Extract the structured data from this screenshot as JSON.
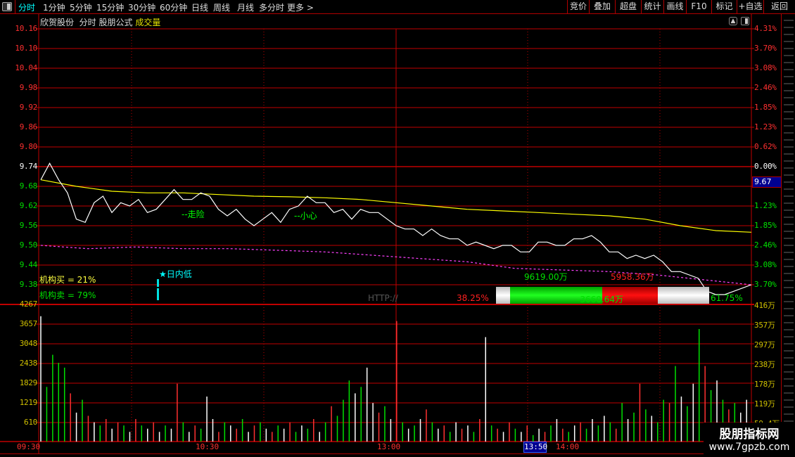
{
  "toolbar": {
    "period_tabs": [
      "分时",
      "1分钟",
      "5分钟",
      "15分钟",
      "30分钟",
      "60分钟",
      "日线",
      "周线",
      "月线",
      "多分时",
      "更多 >"
    ],
    "active_tab": "分时",
    "right_buttons": [
      "竞价",
      "叠加",
      "超盘",
      "统计",
      "画线",
      "F10",
      "标记",
      "+自选",
      "返回"
    ]
  },
  "header": {
    "stock_name": "欣贺股份",
    "view": "分时",
    "formula": "股朋公式",
    "indicator": "成交量"
  },
  "price_axis_left": [
    "10.16",
    "10.10",
    "10.04",
    "9.98",
    "9.92",
    "9.86",
    "9.80",
    "9.74",
    "9.68",
    "9.62",
    "9.56",
    "9.50",
    "9.44",
    "9.38"
  ],
  "pct_axis_right": [
    "4.31%",
    "3.70%",
    "3.08%",
    "2.46%",
    "1.85%",
    "1.23%",
    "0.62%",
    "0.00%",
    "",
    "1.23%",
    "1.85%",
    "2.46%",
    "3.08%",
    "3.70%"
  ],
  "current_price_tag": "9.67",
  "volume_axis_left": [
    "4267",
    "3657",
    "3048",
    "2438",
    "1829",
    "1219",
    "610"
  ],
  "volume_axis_right": [
    "416万",
    "357万",
    "297万",
    "238万",
    "178万",
    "119万",
    "59.4万"
  ],
  "time_axis": [
    "09:30",
    "10:30",
    "13:00",
    "13:50",
    "14:00"
  ],
  "annotations": {
    "risk": "--走险",
    "careful": "--小心",
    "intraday_low": "★日内低",
    "inst_buy": "机构买 = 21%",
    "inst_sell": "机构卖 = 79%",
    "http": "HTTP://",
    "buy_pct": "38.25%",
    "sell_pct": "61.75%",
    "net_flow": "-3660.64万",
    "inflow": "9619.00万",
    "outflow": "5958.36万"
  },
  "flow_bar": {
    "buy_fraction": 0.3825,
    "sell_fraction": 0.6175
  },
  "colors": {
    "up": "#ff3030",
    "down": "#00e000",
    "price_line": "#ffffff",
    "avg_line": "#ffff00",
    "ma_line": "#ff40ff",
    "grid": "#c00000",
    "accent": "#00ffff",
    "volume_axis": "#d0c000"
  },
  "series": {
    "price": [
      9.7,
      9.75,
      9.7,
      9.66,
      9.58,
      9.57,
      9.63,
      9.65,
      9.6,
      9.63,
      9.62,
      9.64,
      9.6,
      9.61,
      9.64,
      9.67,
      9.64,
      9.64,
      9.66,
      9.65,
      9.61,
      9.59,
      9.61,
      9.58,
      9.56,
      9.58,
      9.6,
      9.57,
      9.61,
      9.62,
      9.65,
      9.63,
      9.63,
      9.6,
      9.61,
      9.58,
      9.61,
      9.6,
      9.6,
      9.58,
      9.56,
      9.55,
      9.55,
      9.53,
      9.55,
      9.53,
      9.52,
      9.52,
      9.5,
      9.51,
      9.5,
      9.49,
      9.5,
      9.5,
      9.48,
      9.48,
      9.51,
      9.51,
      9.5,
      9.5,
      9.52,
      9.52,
      9.53,
      9.51,
      9.48,
      9.48,
      9.46,
      9.47,
      9.46,
      9.47,
      9.45,
      9.42,
      9.42,
      9.41,
      9.4,
      9.36,
      9.35,
      9.35,
      9.36,
      9.37,
      9.38
    ],
    "avg": [
      9.7,
      9.68,
      9.665,
      9.66,
      9.66,
      9.655,
      9.65,
      9.648,
      9.645,
      9.64,
      9.63,
      9.62,
      9.61,
      9.605,
      9.6,
      9.595,
      9.59,
      9.58,
      9.56,
      9.545,
      9.54
    ],
    "ma": [
      9.5,
      9.49,
      9.495,
      9.49,
      9.49,
      9.485,
      9.48,
      9.47,
      9.46,
      9.45,
      9.43,
      9.425,
      9.42,
      9.41,
      9.395,
      9.38
    ],
    "volume": [
      3900,
      1700,
      2700,
      2450,
      2300,
      1500,
      900,
      1300,
      800,
      600,
      500,
      700,
      400,
      600,
      500,
      300,
      700,
      500,
      400,
      600,
      300,
      500,
      400,
      1800,
      600,
      300,
      500,
      400,
      1400,
      700,
      300,
      600,
      500,
      400,
      700,
      300,
      500,
      600,
      400,
      300,
      500,
      400,
      600,
      300,
      500,
      400,
      700,
      300,
      600,
      1100,
      800,
      1300,
      1900,
      1500,
      1700,
      2300,
      1200,
      900,
      1100,
      700,
      3750,
      600,
      400,
      500,
      700,
      1000,
      600,
      400,
      500,
      300,
      600,
      400,
      500,
      300,
      700,
      3250,
      500,
      400,
      300,
      600,
      400,
      300,
      500,
      200,
      400,
      300,
      500,
      700,
      400,
      300,
      500,
      600,
      400,
      700,
      500,
      800,
      600,
      400,
      1200,
      700,
      900,
      1800,
      1000,
      800,
      600,
      1300,
      1200,
      2350,
      1400,
      1100,
      1800,
      3500,
      2350,
      1600,
      1900,
      1300,
      1000,
      1200,
      900,
      1300
    ],
    "volume_colors": "wggggrwgrwgrwrgwrgwrwgwrgwrgwwrgwrgwrgwrgwrgwgrwgrgggwgwwrgwrgwgwrgwrgwrwgrwgrwrgwrgwrgwrgwrgwgwgrgwgrgwggrgwgwgrgwgrgw"
  },
  "watermark": {
    "name": "股朋指标网",
    "url": "www.7gpzb.com"
  }
}
